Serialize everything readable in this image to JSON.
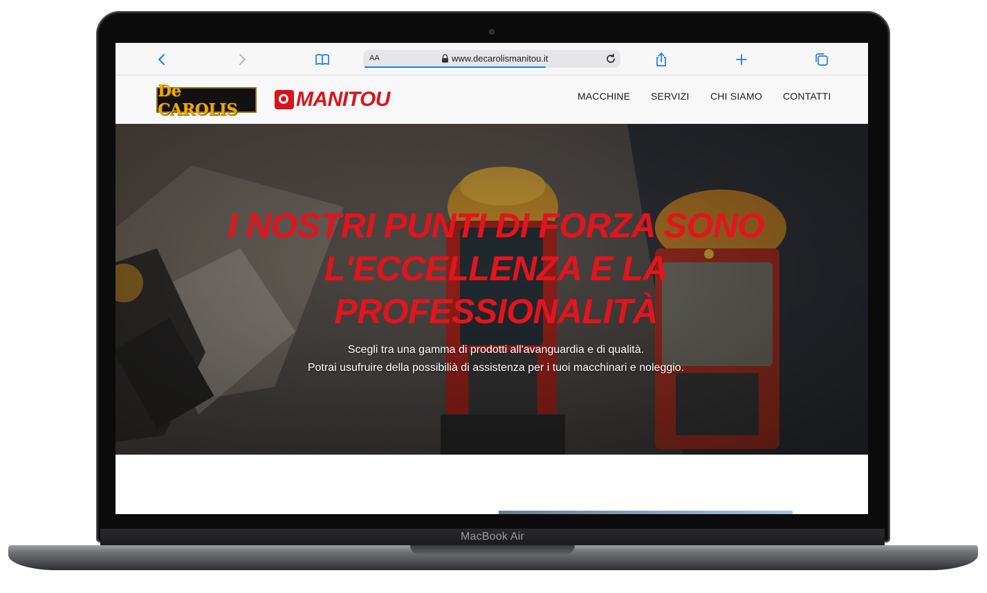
{
  "device": {
    "label": "MacBook Air"
  },
  "browser": {
    "url": "www.decarolismanitou.it",
    "text_size_label": "AA",
    "icons": [
      "back-icon",
      "forward-icon",
      "bookmarks-icon",
      "lock-icon",
      "reload-icon",
      "share-icon",
      "new-tab-icon",
      "tabs-icon"
    ]
  },
  "site": {
    "logos": {
      "decarolis": "De CAROLIS",
      "manitou": "MANITOU"
    },
    "nav": [
      "MACCHINE",
      "SERVIZI",
      "CHI SIAMO",
      "CONTATTI"
    ],
    "hero": {
      "title": "I NOSTRI PUNTI DI FORZA SONO L'ECCELLENZA E LA PROFESSIONALITÀ",
      "subtitle_1": "Scegli tra una gamma di prodotti all'avanguardia e di qualità.",
      "subtitle_2": "Potrai usufruire della possibilià di assistenza per i tuoi macchinari e noleggio."
    }
  },
  "colors": {
    "brand_red": "#e4141c",
    "link_blue": "#1b7cf2",
    "logo_gold": "#f2a800"
  }
}
